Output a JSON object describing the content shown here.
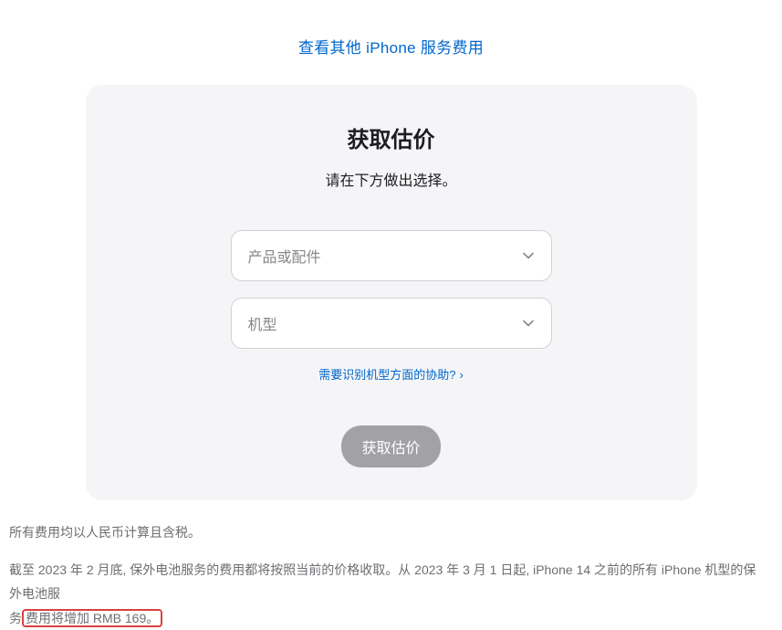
{
  "topLink": {
    "text": "查看其他 iPhone 服务费用"
  },
  "card": {
    "title": "获取估价",
    "subtitle": "请在下方做出选择。",
    "dropdown1Placeholder": "产品或配件",
    "dropdown2Placeholder": "机型",
    "helpLink": "需要识别机型方面的协助?",
    "buttonLabel": "获取估价"
  },
  "footer": {
    "line1": "所有费用均以人民币计算且含税。",
    "line2a": "截至 2023 年 2 月底, 保外电池服务的费用都将按照当前的价格收取。从 2023 年 3 月 1 日起, iPhone 14 之前的所有 iPhone 机型的保外电池服",
    "line2b": "务",
    "line2highlight": "费用将增加 RMB 169。"
  }
}
